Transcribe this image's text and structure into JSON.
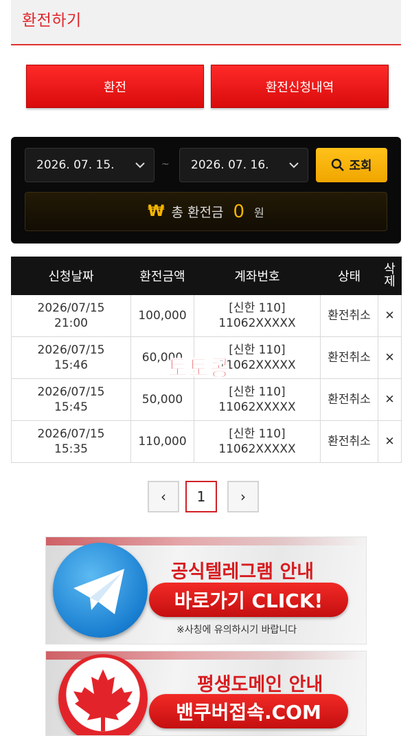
{
  "header": {
    "title": "환전하기"
  },
  "tabs": {
    "exchange_label": "환전",
    "history_label": "환전신청내역"
  },
  "search": {
    "start_date": "2026. 07. 15.",
    "separator": "~",
    "end_date": "2026. 07. 16.",
    "button_label": "조회",
    "icon": "search-icon"
  },
  "summary": {
    "icon": "₩",
    "label": "총 환전금",
    "value": "0",
    "unit": "원"
  },
  "table": {
    "headers": [
      "신청날짜",
      "환전금액",
      "계좌번호",
      "상태",
      "삭\n제"
    ],
    "rows": [
      {
        "date": "2026/07/15",
        "time": "21:00",
        "amount": "100,000",
        "bank": "[신한 110]",
        "account": "11062XXXXX",
        "status": "환전취소",
        "delete": "✕"
      },
      {
        "date": "2026/07/15",
        "time": "15:46",
        "amount": "60,000",
        "bank": "[신한 110]",
        "account": "11062XXXXX",
        "status": "환전취소",
        "delete": "✕"
      },
      {
        "date": "2026/07/15",
        "time": "15:45",
        "amount": "50,000",
        "bank": "[신한 110]",
        "account": "11062XXXXX",
        "status": "환전취소",
        "delete": "✕"
      },
      {
        "date": "2026/07/15",
        "time": "15:35",
        "amount": "110,000",
        "bank": "[신한 110]",
        "account": "11062XXXXX",
        "status": "환전취소",
        "delete": "✕"
      }
    ]
  },
  "pagination": {
    "prev": "‹",
    "current": "1",
    "next": "›"
  },
  "watermark": "토토콩",
  "banners": [
    {
      "heading": "공식텔레그램 안내",
      "button": "바로가기 CLICK!",
      "notice": "※사칭에 유의하시기 바랍니다",
      "icon": "telegram-icon"
    },
    {
      "heading": "평생도메인 안내",
      "button": "밴쿠버접속.COM",
      "icon": "maple-leaf-icon"
    }
  ],
  "colors": {
    "accent_red": "#e0262a",
    "gold": "#f7b500",
    "panel_black": "#0a0a0a"
  }
}
